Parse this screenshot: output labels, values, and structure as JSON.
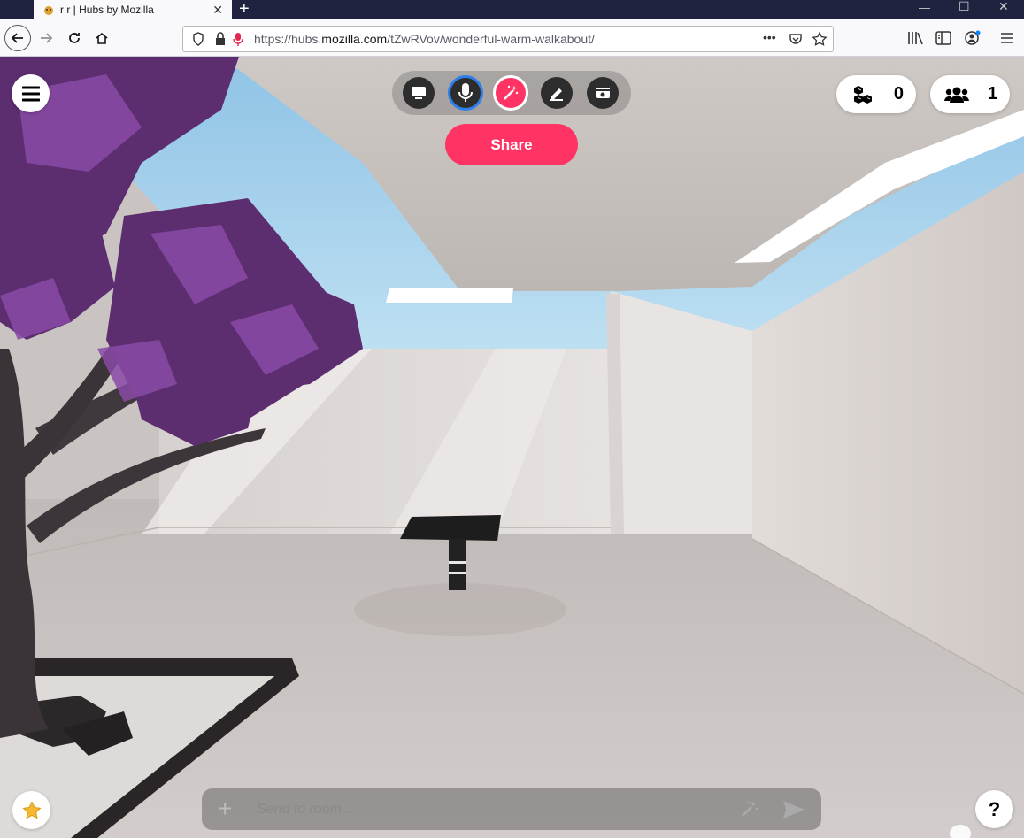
{
  "browser": {
    "tab_title": "r r | Hubs by Mozilla",
    "url_prefix": "https://hubs.",
    "url_domain": "mozilla.com",
    "url_path": "/tZwRVov/wonderful-warm-walkabout/",
    "page_actions_label": "•••"
  },
  "hubs": {
    "share_label": "Share",
    "object_count": "0",
    "people_count": "1",
    "help_label": "?",
    "chat_placeholder": "Send to room...",
    "toolbar_tools": [
      "screen-share",
      "microphone",
      "spawn-magic",
      "pen",
      "camera"
    ],
    "accent_color": "#ff3464",
    "mic_ring_color": "#2f80ed"
  }
}
